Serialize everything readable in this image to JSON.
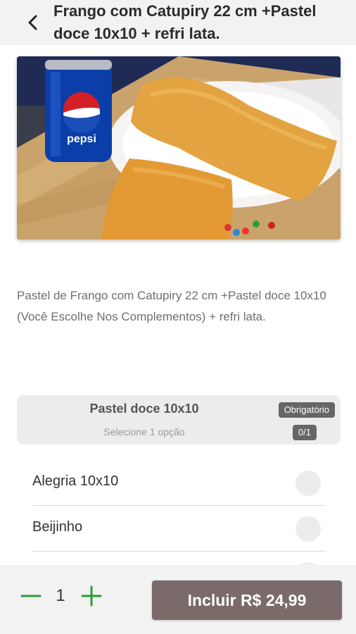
{
  "header": {
    "title": "Frango com Catupiry 22 cm +Pastel doce 10x10 + refri lata."
  },
  "product": {
    "image_text": "pepsi",
    "description": "Pastel de Frango com Catupiry 22 cm +Pastel doce 10x10 (Você Escolhe Nos Complementos) + refri lata."
  },
  "option_group": {
    "title": "Pastel doce 10x10",
    "subtitle": "Selecione 1 opção",
    "required_badge": "Obrigatório",
    "count_badge": "0/1",
    "options": [
      {
        "label": "Alegria 10x10"
      },
      {
        "label": "Beijinho"
      },
      {
        "label": ""
      }
    ]
  },
  "bottom_bar": {
    "quantity": "1",
    "add_button_label": "Incluir R$ 24,99"
  },
  "colors": {
    "accent_green": "#2e9a3a",
    "button_bg": "#7a6a6a",
    "header_bg": "#f3f2f2"
  }
}
